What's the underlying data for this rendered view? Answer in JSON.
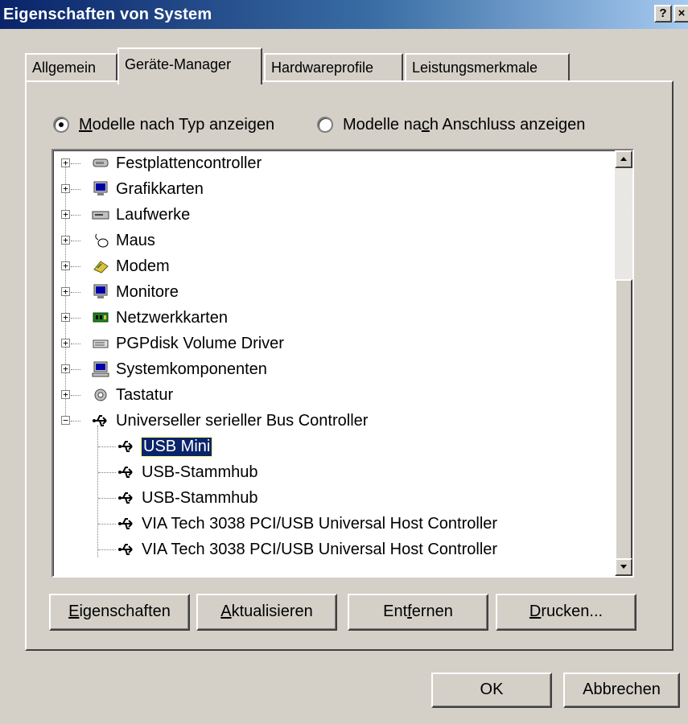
{
  "window": {
    "title": "Eigenschaften von System",
    "help_glyph": "?",
    "close_glyph": "×"
  },
  "tabs": [
    {
      "label": "Allgemein",
      "active": false
    },
    {
      "label": "Geräte-Manager",
      "active": true
    },
    {
      "label": "Hardwareprofile",
      "active": false
    },
    {
      "label": "Leistungsmerkmale",
      "active": false
    }
  ],
  "view_options": {
    "by_type": {
      "label_prefix": "",
      "underlined": "M",
      "label_suffix": "odelle nach Typ anzeigen",
      "checked": true
    },
    "by_connection": {
      "label_prefix": "Modelle na",
      "underlined": "c",
      "label_suffix": "h Anschluss anzeigen",
      "checked": false
    }
  },
  "tree": {
    "categories": [
      {
        "label": "Festplattencontroller",
        "icon": "disk-controller-icon",
        "expanded": false
      },
      {
        "label": "Grafikkarten",
        "icon": "display-adapter-icon",
        "expanded": false
      },
      {
        "label": "Laufwerke",
        "icon": "drive-icon",
        "expanded": false
      },
      {
        "label": "Maus",
        "icon": "mouse-icon",
        "expanded": false
      },
      {
        "label": "Modem",
        "icon": "modem-icon",
        "expanded": false
      },
      {
        "label": "Monitore",
        "icon": "monitor-icon",
        "expanded": false
      },
      {
        "label": "Netzwerkkarten",
        "icon": "network-card-icon",
        "expanded": false
      },
      {
        "label": "PGPdisk Volume Driver",
        "icon": "volume-driver-icon",
        "expanded": false
      },
      {
        "label": "Systemkomponenten",
        "icon": "system-components-icon",
        "expanded": false
      },
      {
        "label": "Tastatur",
        "icon": "keyboard-icon",
        "expanded": false
      },
      {
        "label": "Universeller serieller Bus Controller",
        "icon": "usb-icon",
        "expanded": true
      }
    ],
    "usb_children": [
      {
        "label": "USB Mini",
        "selected": true
      },
      {
        "label": "USB-Stammhub",
        "selected": false
      },
      {
        "label": "USB-Stammhub",
        "selected": false
      },
      {
        "label": "VIA Tech 3038 PCI/USB Universal Host Controller",
        "selected": false
      },
      {
        "label": "VIA Tech 3038 PCI/USB Universal Host Controller",
        "selected": false
      }
    ],
    "expander_collapsed": "+",
    "expander_expanded": "−"
  },
  "actions": {
    "properties": {
      "underlined": "E",
      "rest": "igenschaften"
    },
    "update": {
      "underlined": "A",
      "rest": "ktualisieren"
    },
    "remove": {
      "prefix": "Ent",
      "underlined": "f",
      "rest": "ernen"
    },
    "print": {
      "underlined": "D",
      "rest": "rucken..."
    }
  },
  "dialog": {
    "ok_label": "OK",
    "cancel_label": "Abbrechen"
  },
  "colors": {
    "face": "#d4d0c8",
    "title_start": "#0a246a",
    "title_end": "#a6caf0",
    "selection": "#0a246a"
  }
}
